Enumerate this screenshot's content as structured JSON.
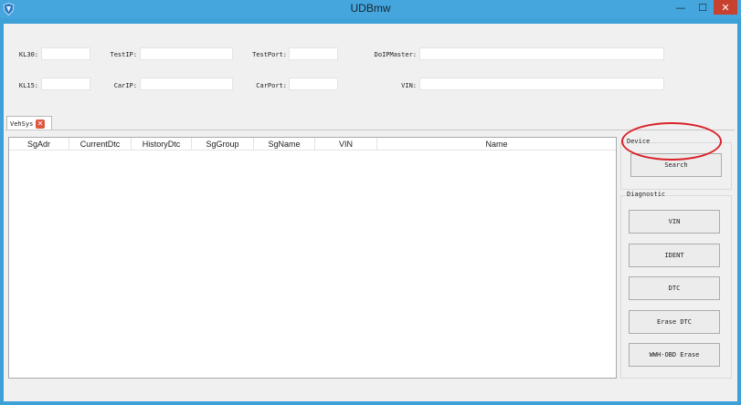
{
  "window": {
    "title": "UDBmw",
    "minimize": "—",
    "maximize": "☐",
    "close": "✕"
  },
  "fields": {
    "kl30": {
      "label": "KL30:",
      "value": ""
    },
    "test_ip": {
      "label": "TestIP:",
      "value": ""
    },
    "test_port": {
      "label": "TestPort:",
      "value": ""
    },
    "doip_master": {
      "label": "DoIPMaster:",
      "value": ""
    },
    "kl15": {
      "label": "KL15:",
      "value": ""
    },
    "car_ip": {
      "label": "CarIP:",
      "value": ""
    },
    "car_port": {
      "label": "CarPort:",
      "value": ""
    },
    "vin": {
      "label": "VIN:",
      "value": ""
    }
  },
  "tab": {
    "label": "VehSys",
    "close": "✕"
  },
  "table": {
    "columns": [
      "SgAdr",
      "CurrentDtc",
      "HistoryDtc",
      "SgGroup",
      "SgName",
      "VIN",
      "Name"
    ],
    "rows": []
  },
  "device": {
    "title": "Device",
    "search_label": "Search"
  },
  "diagnostic": {
    "title": "Diagnostic",
    "buttons": [
      "VIN",
      "IDENT",
      "DTC",
      "Erase DTC",
      "WWH-OBD Erase"
    ]
  },
  "colors": {
    "title_bar": "#44a6dc",
    "client": "#f0f0f0",
    "highlight": "#d9222a",
    "close_button": "#c7412f"
  }
}
